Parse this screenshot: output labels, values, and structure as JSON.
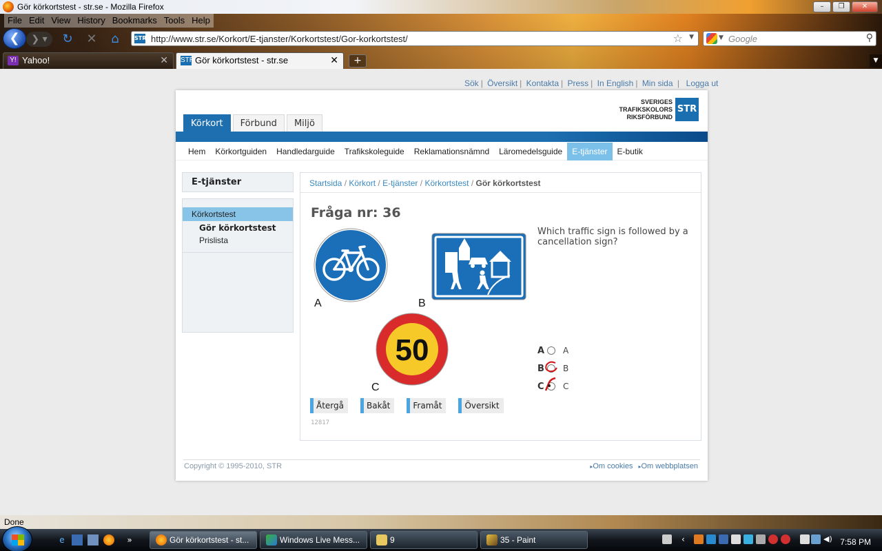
{
  "window": {
    "title": "Gör körkortstest - str.se - Mozilla Firefox"
  },
  "menu": [
    "File",
    "Edit",
    "View",
    "History",
    "Bookmarks",
    "Tools",
    "Help"
  ],
  "nav": {
    "url": "http://www.str.se/Korkort/E-tjanster/Korkortstest/Gor-korkortstest/",
    "site_icon_text": "STR",
    "search_placeholder": "Google"
  },
  "tabs": [
    {
      "label": "Yahoo!",
      "active": false
    },
    {
      "label": "Gör körkortstest - str.se",
      "active": true
    }
  ],
  "toplinks": [
    "Sök",
    "Översikt",
    "Kontakta",
    "Press",
    "In English",
    "Min sida",
    "Logga ut"
  ],
  "logo": {
    "line1": "SVERIGES",
    "line2": "TRAFIKSKOLORS",
    "line3": "RIKSFÖRBUND",
    "box": "STR"
  },
  "main_tabs": [
    "Körkort",
    "Förbund",
    "Miljö"
  ],
  "subnav": [
    "Hem",
    "Körkortguiden",
    "Handledarguide",
    "Trafikskoleguide",
    "Reklamationsnämnd",
    "Läromedelsguide",
    "E-tjänster",
    "E-butik"
  ],
  "sidebar": {
    "heading": "E-tjänster",
    "items": [
      "Körkortstest",
      "Gör körkortstest",
      "Prislista"
    ]
  },
  "breadcrumb": {
    "links": [
      "Startsida",
      "Körkort",
      "E-tjänster",
      "Körkortstest"
    ],
    "sep": " / ",
    "current": "Gör körkortstest"
  },
  "question": {
    "title": "Fråga nr: 36",
    "text": "Which traffic sign is followed by a cancellation sign?",
    "sign_labels": [
      "A",
      "B",
      "C"
    ],
    "speed_value": "50",
    "options": [
      {
        "letter": "A",
        "value": "A"
      },
      {
        "letter": "B",
        "value": "B"
      },
      {
        "letter": "C",
        "value": "C"
      }
    ],
    "buttons": [
      "Återgå",
      "Bakåt",
      "Framåt",
      "Översikt"
    ],
    "id": "12817"
  },
  "footer": {
    "copyright": "Copyright © 1995-2010, STR",
    "links": [
      "Om cookies",
      "Om webbplatsen"
    ]
  },
  "status": "Done",
  "taskbar": {
    "items": [
      "Gör körkortstest - st...",
      "Windows Live Mess...",
      "9",
      "35 - Paint"
    ],
    "clock": "7:58 PM"
  },
  "colors": {
    "brand_blue": "#1d6fb0",
    "link": "#3a8ac0",
    "sub_active": "#7ac0e8"
  }
}
